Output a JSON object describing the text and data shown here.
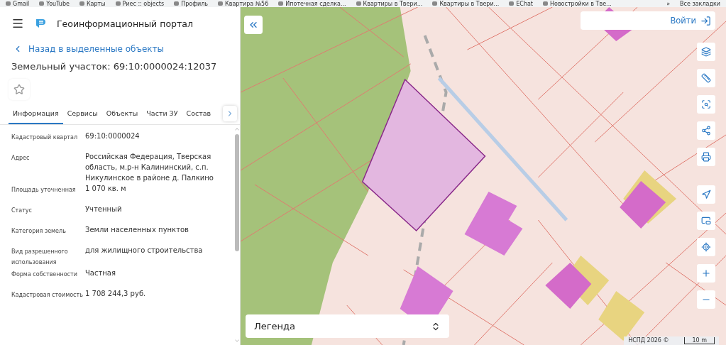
{
  "bookmarks": {
    "items": [
      "Gmail",
      "YouTube",
      "Карты",
      "Риес :: objects",
      "Профиль",
      "Квартира №56",
      "Ипотечная сделка...",
      "Квартиры в Твери...",
      "Квартиры в Твери...",
      "EChat",
      "Новостройки в Тве..."
    ],
    "more": "»",
    "all": "Все закладки"
  },
  "header": {
    "title": "Геоинформационный портал"
  },
  "back_link": "Назад в выделенные объекты",
  "object_title": "Земельный участок: 69:10:0000024:12037",
  "favorite": {
    "selected": false
  },
  "tabs": [
    {
      "label": "Информация",
      "selected": true
    },
    {
      "label": "Сервисы",
      "selected": false
    },
    {
      "label": "Объекты",
      "selected": false
    },
    {
      "label": "Части ЗУ",
      "selected": false
    },
    {
      "label": "Состав",
      "selected": false
    }
  ],
  "fields": [
    {
      "label": "Кадастровый квартал",
      "value": "69:10:0000024"
    },
    {
      "label": "Адрес",
      "value": "Российская Федерация, Тверская область, м.р-н Калининский, с.п. Никулинское в районе д. Палкино"
    },
    {
      "label": "Площадь уточненная",
      "value": "1 070 кв. м"
    },
    {
      "label": "Статус",
      "value": "Учтенный"
    },
    {
      "label": "Категория земель",
      "value": "Земли населенных пунктов"
    },
    {
      "label": "Вид разрешенного использования",
      "value": "для жилищного строительства"
    },
    {
      "label": "Форма собственности",
      "value": "Частная"
    },
    {
      "label": "Кадастровая стоимость",
      "value": "1 708 244,3 руб."
    }
  ],
  "map": {
    "login": "Войти",
    "legend": "Легенда",
    "attribution": "НСПД 2026 ©",
    "scale": "10 m",
    "tools": [
      {
        "kind": "layers"
      },
      {
        "kind": "ruler"
      },
      {
        "kind": "select"
      },
      {
        "kind": "share"
      },
      {
        "kind": "print"
      },
      {
        "kind": "locate"
      },
      {
        "kind": "minimap"
      },
      {
        "kind": "search-point"
      },
      {
        "kind": "zoom-in"
      },
      {
        "kind": "zoom-out"
      }
    ]
  }
}
